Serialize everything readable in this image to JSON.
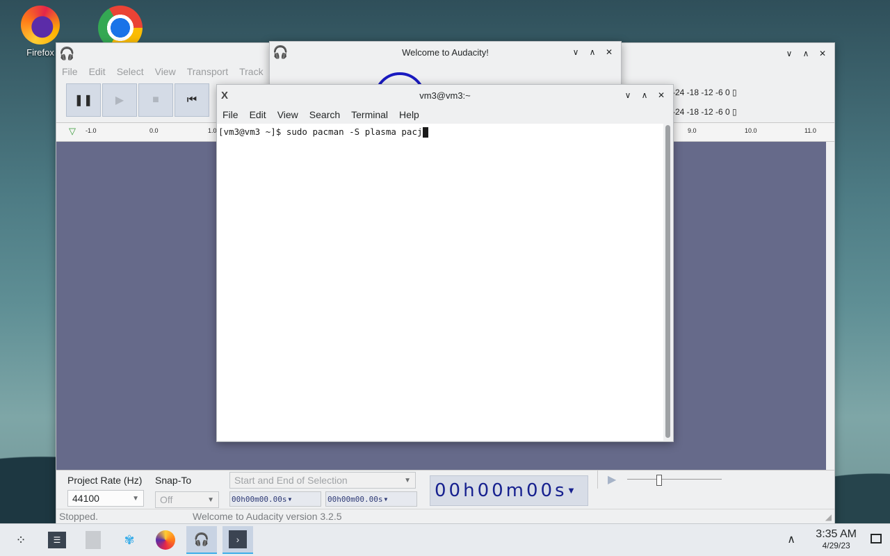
{
  "desktop": {
    "icons": [
      {
        "label": "Firefox"
      },
      {
        "label": ""
      }
    ]
  },
  "audacity": {
    "menu": [
      "File",
      "Edit",
      "Select",
      "View",
      "Transport",
      "Track"
    ],
    "ruler_ticks": [
      "-1.0",
      "0.0",
      "1.0",
      "9.0",
      "10.0",
      "11.0"
    ],
    "meter_scale": "-24 -18 -12  -6  0",
    "project_rate_label": "Project Rate (Hz)",
    "project_rate_value": "44100",
    "snap_to_label": "Snap-To",
    "snap_to_value": "Off",
    "selection_mode": "Start and End of Selection",
    "sel_start": "00h00m00.00s",
    "sel_end": "00h00m00.00s",
    "audio_position": "00h00m00s",
    "status_left": "Stopped.",
    "status_right": "Welcome to Audacity version 3.2.5"
  },
  "welcome": {
    "title": "Welcome to Audacity!"
  },
  "terminal": {
    "title": "vm3@vm3:~",
    "menu": [
      "File",
      "Edit",
      "View",
      "Search",
      "Terminal",
      "Help"
    ],
    "line": "[vm3@vm3 ~]$ sudo pacman -S plasma pacj"
  },
  "taskbar": {
    "time": "3:35 AM",
    "date": "4/29/23"
  },
  "colors": {
    "track_bg": "#666a8a",
    "accent": "#3daee9"
  }
}
